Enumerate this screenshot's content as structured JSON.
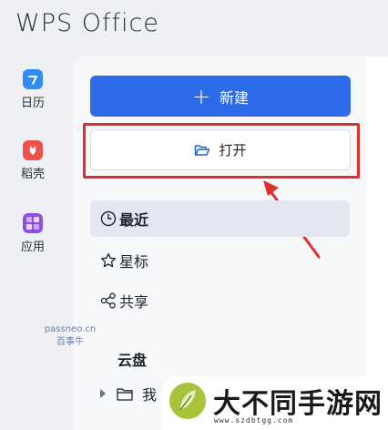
{
  "app": {
    "title": "WPS Office"
  },
  "rail": {
    "items": [
      {
        "label": "日历",
        "icon": "calendar-icon",
        "color": "#2f8cf5"
      },
      {
        "label": "稻壳",
        "icon": "docer-icon",
        "color": "#f0504b"
      },
      {
        "label": "应用",
        "icon": "apps-icon",
        "color": "#8e4fe6"
      }
    ]
  },
  "actions": {
    "new_label": "新建",
    "open_label": "打开"
  },
  "nav": {
    "items": [
      {
        "label": "最近",
        "icon": "clock-icon",
        "active": true
      },
      {
        "label": "星标",
        "icon": "star-icon",
        "active": false
      },
      {
        "label": "共享",
        "icon": "share-icon",
        "active": false
      }
    ]
  },
  "watermark": {
    "line1": "passneo.cn",
    "line2": "百事牛"
  },
  "cloud": {
    "section_title": "云盘",
    "tree": [
      {
        "label": "我"
      }
    ]
  },
  "logo": {
    "text": "大不同手游网",
    "url": "www.szdbtgg.com"
  },
  "colors": {
    "primary": "#2e6bea",
    "highlight": "#e02f2b",
    "panel": "#f7f8fa",
    "active_bg": "#e2e7f1"
  }
}
